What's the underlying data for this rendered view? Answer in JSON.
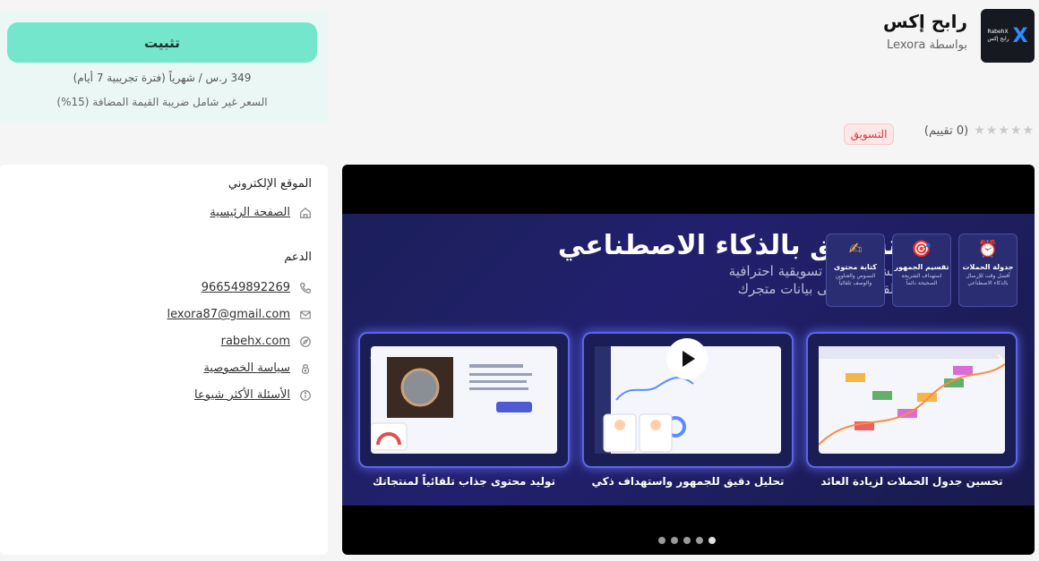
{
  "install": {
    "button_label": "تثبيت",
    "price": "349 ر.س / شهرياً (فترة تجريبية 7 أيام)",
    "vat_note": "السعر غير شامل ضريبة القيمة المضافة (15%)"
  },
  "app": {
    "logo_top": "RabehX",
    "logo_bottom": "رابح إكس",
    "title": "رابح إكس",
    "by": "بواسطة Lexora",
    "rating_text": "(0 تقييم)",
    "category": "التسويق"
  },
  "sidebar": {
    "website_title": "الموقع الإلكتروني",
    "home_link": "الصفحة الرئيسية",
    "support_title": "الدعم",
    "phone": "966549892269",
    "email": "lexora87@gmail.com",
    "website": "rabehx.com",
    "privacy": "سياسة الخصوصية",
    "faq": "الأسئلة الأكثر شيوعا"
  },
  "media": {
    "title": "تسويق بالذكاء الاصطناعي",
    "subtitle_1": "أنشئ حملات تسويقية احترافية",
    "subtitle_2": "تلقائياً بناءً على بيانات متجرك",
    "features": [
      {
        "icon": "⏰",
        "name": "جدولة الحملات",
        "desc": "أفضل وقت للإرسال بالذكاء الاصطناعي"
      },
      {
        "icon": "🎯",
        "name": "تقسيم الجمهور",
        "desc": "استهداف الشريحة الصحيحة دائماً"
      },
      {
        "icon": "✍",
        "name": "كتابة محتوى",
        "desc": "النصوص والعناوين والوصف تلقائياً"
      }
    ],
    "captions": [
      "تحسين جدول الحملات لزيادة العائد",
      "تحليل دقيق للجمهور واستهداف ذكي",
      "توليد محتوى جذاب تلقائياً لمنتجاتك"
    ],
    "slides_total": 5,
    "slide_active": 5
  }
}
